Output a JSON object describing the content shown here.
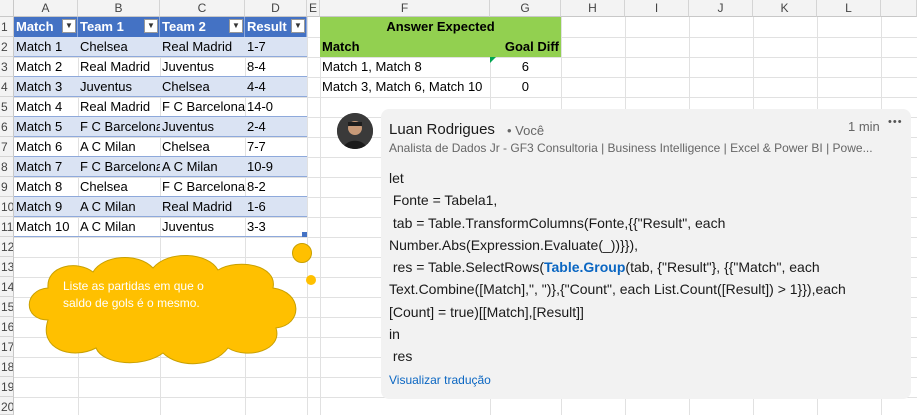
{
  "columns": [
    "A",
    "B",
    "C",
    "D",
    "E",
    "F",
    "G",
    "H",
    "I",
    "J",
    "K",
    "L"
  ],
  "rows": [
    "1",
    "2",
    "3",
    "4",
    "5",
    "6",
    "7",
    "8",
    "9",
    "10",
    "11",
    "12",
    "13",
    "14",
    "15",
    "16",
    "17",
    "18",
    "19",
    "20"
  ],
  "table": {
    "headers": [
      "Match",
      "Team 1",
      "Team 2",
      "Result"
    ],
    "rows": [
      [
        "Match 1",
        "Chelsea",
        "Real Madrid",
        "1-7"
      ],
      [
        "Match 2",
        "Real Madrid",
        "Juventus",
        "8-4"
      ],
      [
        "Match 3",
        "Juventus",
        "Chelsea",
        "4-4"
      ],
      [
        "Match 4",
        "Real Madrid",
        "F C Barcelona",
        "14-0"
      ],
      [
        "Match 5",
        "F C Barcelona",
        "Juventus",
        "2-4"
      ],
      [
        "Match 6",
        "A C Milan",
        "Chelsea",
        "7-7"
      ],
      [
        "Match 7",
        "F C Barcelona",
        "A C Milan",
        "10-9"
      ],
      [
        "Match 8",
        "Chelsea",
        "F C Barcelona",
        "8-2"
      ],
      [
        "Match 9",
        "A C Milan",
        "Real Madrid",
        "1-6"
      ],
      [
        "Match 10",
        "A C Milan",
        "Juventus",
        "3-3"
      ]
    ]
  },
  "answer": {
    "title": "Answer Expected",
    "col_match": "Match",
    "col_goal": "Goal Diff",
    "rows": [
      {
        "match": "Match 1, Match 8",
        "goal": "6"
      },
      {
        "match": "Match 3, Match 6, Match 10",
        "goal": "0"
      }
    ]
  },
  "callout": {
    "line1": "Liste as partidas em que o",
    "line2": "saldo de gols é o mesmo."
  },
  "comment": {
    "author": "Luan Rodrigues",
    "you_badge": "• Você",
    "time": "1 min",
    "more": "•••",
    "headline": "Analista de Dados Jr - GF3 Consultoria | Business Intelligence | Excel & Power BI | Powe...",
    "code_lines": [
      "let",
      " Fonte = Tabela1,",
      " tab = Table.TransformColumns(Fonte,{{\"Result\", each",
      "Number.Abs(Expression.Evaluate(_))}}),",
      " res = Table.SelectRows(",
      "Text.Combine([Match],\", \")},{\"Count\", each List.Count([Result]) > 1}}),each",
      "[Count] = true)[[Match],[Result]]",
      "in",
      " res"
    ],
    "line5_highlight": "Table.Group",
    "line5_rest": "(tab, {\"Result\"}, {{\"Match\", each",
    "translate_link": "Visualizar tradução"
  },
  "colors": {
    "table_header": "#4472c4",
    "table_band": "#dae3f3",
    "answer_fill": "#92d050",
    "callout_fill": "#ffc000",
    "link": "#0a66c2"
  }
}
